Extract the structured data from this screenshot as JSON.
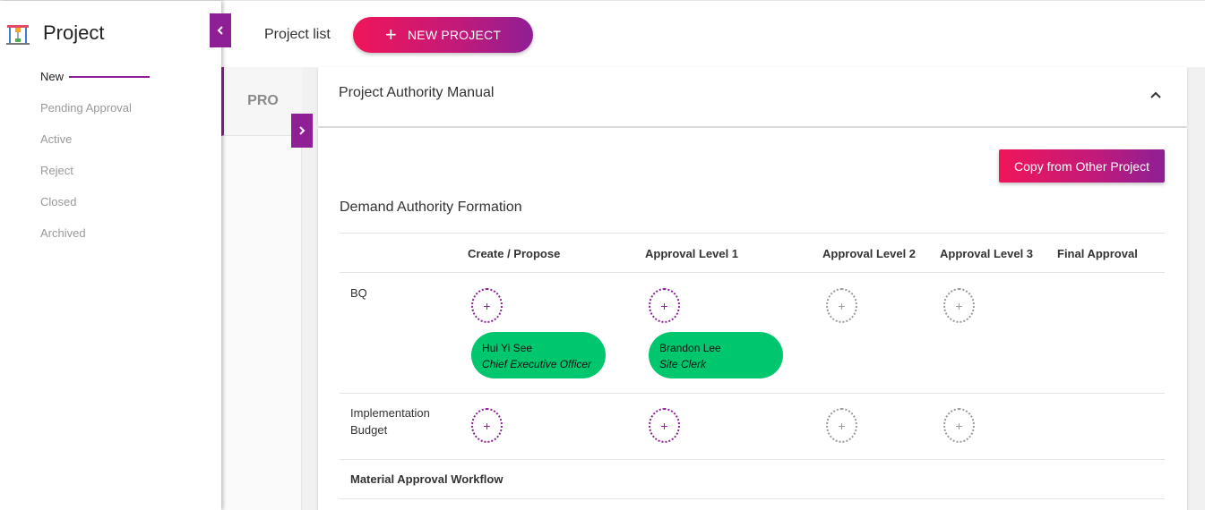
{
  "sidebar": {
    "title": "Project",
    "items": [
      {
        "label": "New",
        "active": true
      },
      {
        "label": "Pending Approval",
        "active": false
      },
      {
        "label": "Active",
        "active": false
      },
      {
        "label": "Reject",
        "active": false
      },
      {
        "label": "Closed",
        "active": false
      },
      {
        "label": "Archived",
        "active": false
      }
    ]
  },
  "header": {
    "title": "Project list",
    "new_project_label": "NEW PROJECT"
  },
  "tab": {
    "label": "PRO"
  },
  "accordion": {
    "title": "Project Authority Manual"
  },
  "card": {
    "copy_label": "Copy from Other Project",
    "section_title": "Demand Authority Formation",
    "columns": [
      "Create / Propose",
      "Approval Level 1",
      "Approval Level 2",
      "Approval Level 3",
      "Final Approval"
    ],
    "rows": [
      {
        "label": "BQ",
        "assignees": [
          {
            "name": "Hui Yi See",
            "role": "Chief Executive Officer"
          },
          {
            "name": "Brandon Lee",
            "role": "Site Clerk"
          }
        ]
      },
      {
        "label": "Implementation Budget"
      },
      {
        "label": "Material Approval Workflow"
      }
    ],
    "add_symbol": "+"
  },
  "colors": {
    "brand_purple": "#8e1f95",
    "brand_pink": "#f0155a",
    "pill_green": "#00c66e"
  }
}
